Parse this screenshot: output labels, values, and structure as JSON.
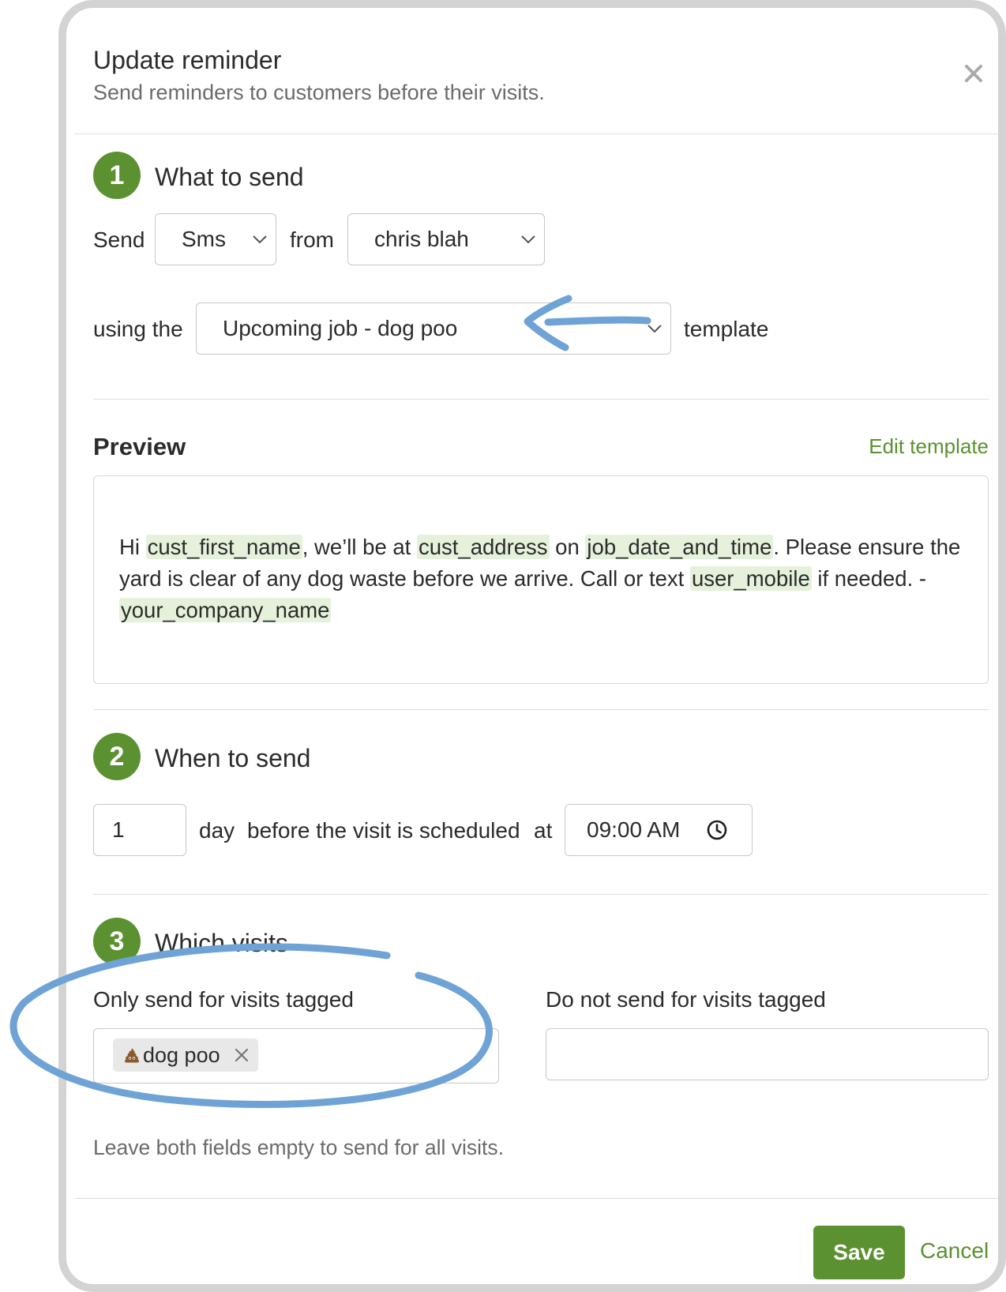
{
  "header": {
    "title": "Update reminder",
    "subtitle": "Send reminders to customers before their visits."
  },
  "step1": {
    "number": "1",
    "title": "What to send",
    "send_label": "Send",
    "channel": "Sms",
    "from_label": "from",
    "sender": "chris blah",
    "using_label": "using the",
    "template": "Upcoming job - dog poo",
    "template_label": "template"
  },
  "preview": {
    "title": "Preview",
    "edit_link": "Edit template",
    "parts": {
      "p1": "Hi ",
      "v1": "cust_first_name",
      "p2": ", we’ll be at ",
      "v2": "cust_address",
      "p3": " on ",
      "v3": "job_date_and_time",
      "p4": ". Please ensure the yard is clear of any dog waste before we arrive. Call or text ",
      "v4": "user_mobile",
      "p5": " if needed. - ",
      "v5": "your_company_name"
    }
  },
  "step2": {
    "number": "2",
    "title": "When to send",
    "count": "1",
    "unit": "day",
    "relation": "before the visit is scheduled",
    "at_label": "at",
    "time": "09:00 AM"
  },
  "step3": {
    "number": "3",
    "title": "Which visits",
    "include_label": "Only send for visits tagged",
    "include_tag": "dog poo",
    "exclude_label": "Do not send for visits tagged",
    "help": "Leave both fields empty to send for all visits."
  },
  "footer": {
    "save": "Save",
    "cancel": "Cancel"
  },
  "icons": {
    "close": "close-icon",
    "chevron": "chevron-down-icon",
    "clock": "clock-icon",
    "tag_emoji": "poop-emoji-icon",
    "remove": "remove-tag-icon"
  },
  "colors": {
    "accent": "#5b9130",
    "variable_highlight": "#e6f1dc",
    "annotation": "#6fa3d6"
  }
}
